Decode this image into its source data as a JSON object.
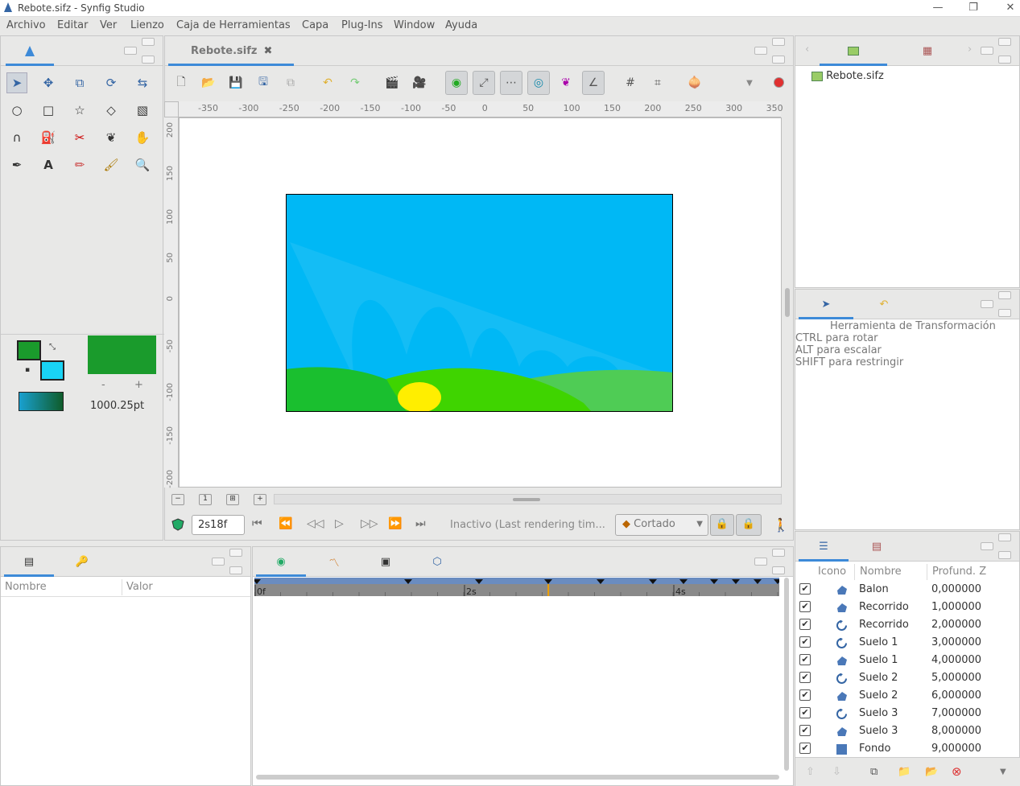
{
  "window": {
    "title": "Rebote.sifz - Synfig Studio",
    "minimize": "—",
    "restore": "❐",
    "close": "✕"
  },
  "menu": [
    "Archivo",
    "Editar",
    "Ver",
    "Lienzo",
    "Caja de Herramientas",
    "Capa",
    "Plug-Ins",
    "Window",
    "Ayuda"
  ],
  "document_tab": {
    "label": "Rebote.sifz",
    "close": "✖"
  },
  "ruler_h_ticks": [
    "-350",
    "-300",
    "-250",
    "-200",
    "-150",
    "-100",
    "-50",
    "0",
    "50",
    "100",
    "150",
    "200",
    "250",
    "300",
    "350"
  ],
  "ruler_v_ticks": [
    "200",
    "150",
    "100",
    "50",
    "0",
    "-50",
    "-100",
    "-150",
    "-200"
  ],
  "colors": {
    "outline": "#1a9b2c",
    "fill": "#19d3f5",
    "brush_preview": "#1a9b2c",
    "sky": "#00b8f5",
    "hill_dark": "#1abf2f",
    "hill_mid": "#3fd400",
    "hill_light": "#4fcc55",
    "ball": "#ffee00",
    "accent": "#3d8ad8",
    "record": "#e03030"
  },
  "brush": {
    "minus": "-",
    "plus": "+",
    "size": "1000.25pt"
  },
  "frame": {
    "current": "2s18f",
    "status": "Inactivo (Last rendering tim...",
    "interp": "Cortado"
  },
  "params": {
    "col_name": "Nombre",
    "col_value": "Valor"
  },
  "timeline": {
    "labels": [
      "0f",
      "2s",
      "4s"
    ],
    "playhead": 0.56
  },
  "canvas_browser": {
    "file": "Rebote.sifz"
  },
  "tool_options": {
    "title": "Herramienta de Transformación",
    "lines": [
      "CTRL para rotar",
      "ALT para escalar",
      "SHIFT para restringir"
    ]
  },
  "layers": {
    "col_icon": "Icono",
    "col_name": "Nombre",
    "col_z": "Profund. Z",
    "rows": [
      {
        "name": "Balon",
        "z": "0,000000",
        "icon": "region-icon"
      },
      {
        "name": "Recorrido",
        "z": "1,000000",
        "icon": "region-icon"
      },
      {
        "name": "Recorrido",
        "z": "2,000000",
        "icon": "rotate-layer-icon"
      },
      {
        "name": "Suelo 1",
        "z": "3,000000",
        "icon": "rotate-layer-icon"
      },
      {
        "name": "Suelo 1",
        "z": "4,000000",
        "icon": "region-icon"
      },
      {
        "name": "Suelo 2",
        "z": "5,000000",
        "icon": "rotate-layer-icon"
      },
      {
        "name": "Suelo 2",
        "z": "6,000000",
        "icon": "region-icon"
      },
      {
        "name": "Suelo 3",
        "z": "7,000000",
        "icon": "rotate-layer-icon"
      },
      {
        "name": "Suelo 3",
        "z": "8,000000",
        "icon": "region-icon"
      },
      {
        "name": "Fondo",
        "z": "9,000000",
        "icon": "rectangle-layer-icon"
      }
    ]
  }
}
